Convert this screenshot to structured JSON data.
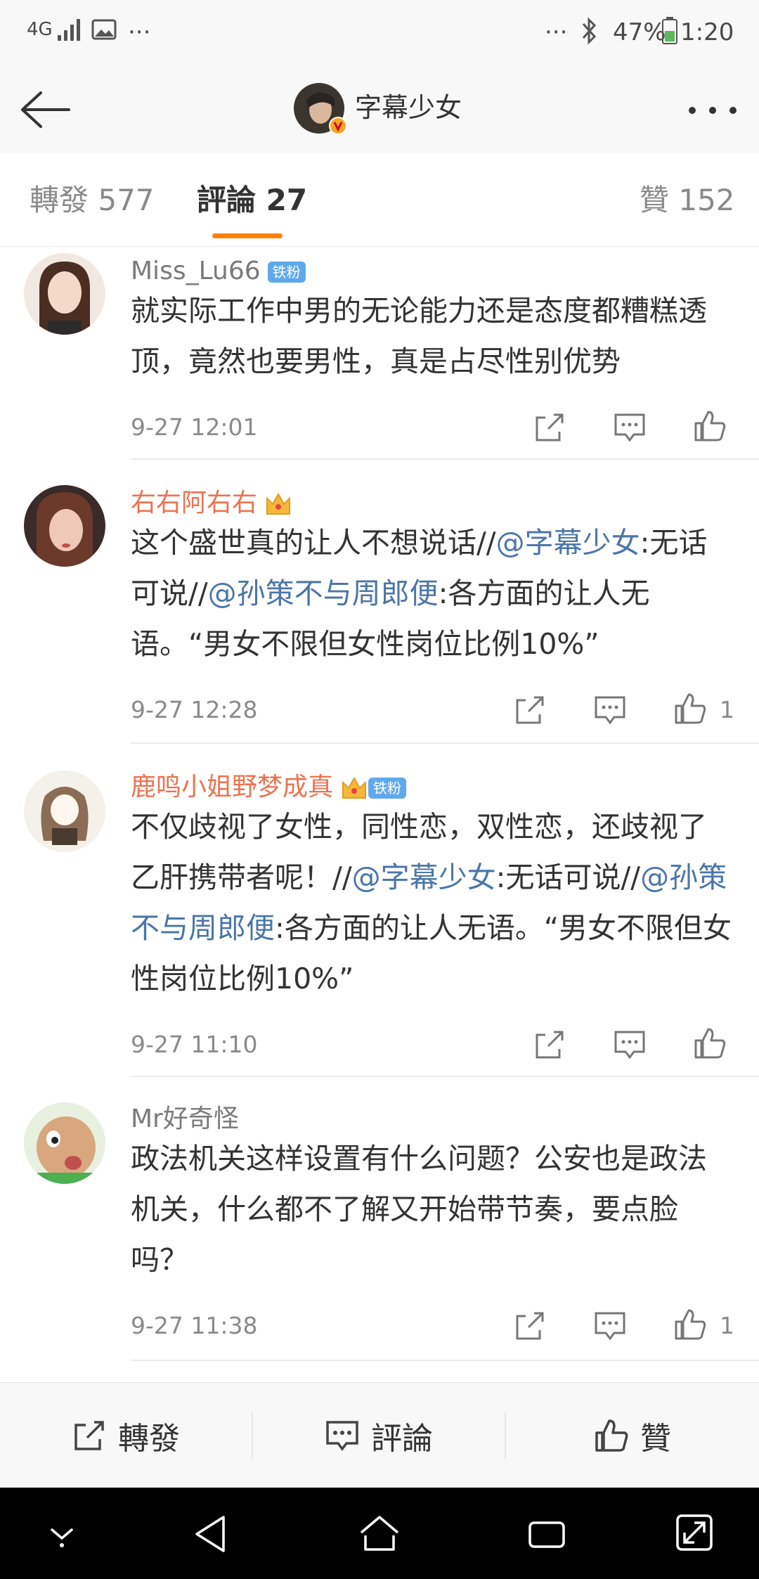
{
  "status_bar": {
    "network": "4G",
    "more_left": "···",
    "more_right": "···",
    "battery": "47%",
    "time": "1:20"
  },
  "nav": {
    "title": "字幕少女"
  },
  "tabs": [
    {
      "label": "轉發 577"
    },
    {
      "label": "評論 27"
    },
    {
      "label": "贊 152"
    }
  ],
  "comments": [
    {
      "username": "Miss_Lu66",
      "badge": "铁粉",
      "text": "就实际工作中男的无论能力还是态度都糟糕透顶，竟然也要男性，真是占尽性别优势",
      "time": "9-27 12:01",
      "likes": ""
    },
    {
      "username": "右右阿右右",
      "badge": "",
      "text_parts": [
        "这个盛世真的让人不想说话//",
        "@字幕少女",
        ":无话可说//",
        "@孙策不与周郎便",
        ":各方面的让人无语。“男女不限但女性岗位比例10%”"
      ],
      "time": "9-27 12:28",
      "likes": "1"
    },
    {
      "username": "鹿鸣小姐野梦成真",
      "badge": "铁粉",
      "text_parts": [
        "不仅歧视了女性，同性恋，双性恋，还歧视了乙肝携带者呢！//",
        "@字幕少女",
        ":无话可说//",
        "@孙策不与周郎便",
        ":各方面的让人无语。“男女不限但女性岗位比例10%”"
      ],
      "time": "9-27 11:10",
      "likes": ""
    },
    {
      "username": "Mr好奇怪",
      "badge": "",
      "text": "政法机关这样设置有什么问题？公安也是政法机关，什么都不了解又开始带节奏，要点脸吗？",
      "time": "9-27 11:38",
      "likes": "1"
    }
  ],
  "bottom_bar": {
    "repost": "轉發",
    "comment": "評論",
    "like": "贊"
  },
  "colors": {
    "accent": "#ff8200",
    "mention": "#4b76a8",
    "vip_name": "#eb7350",
    "fan_badge": "#5fa8ec"
  }
}
